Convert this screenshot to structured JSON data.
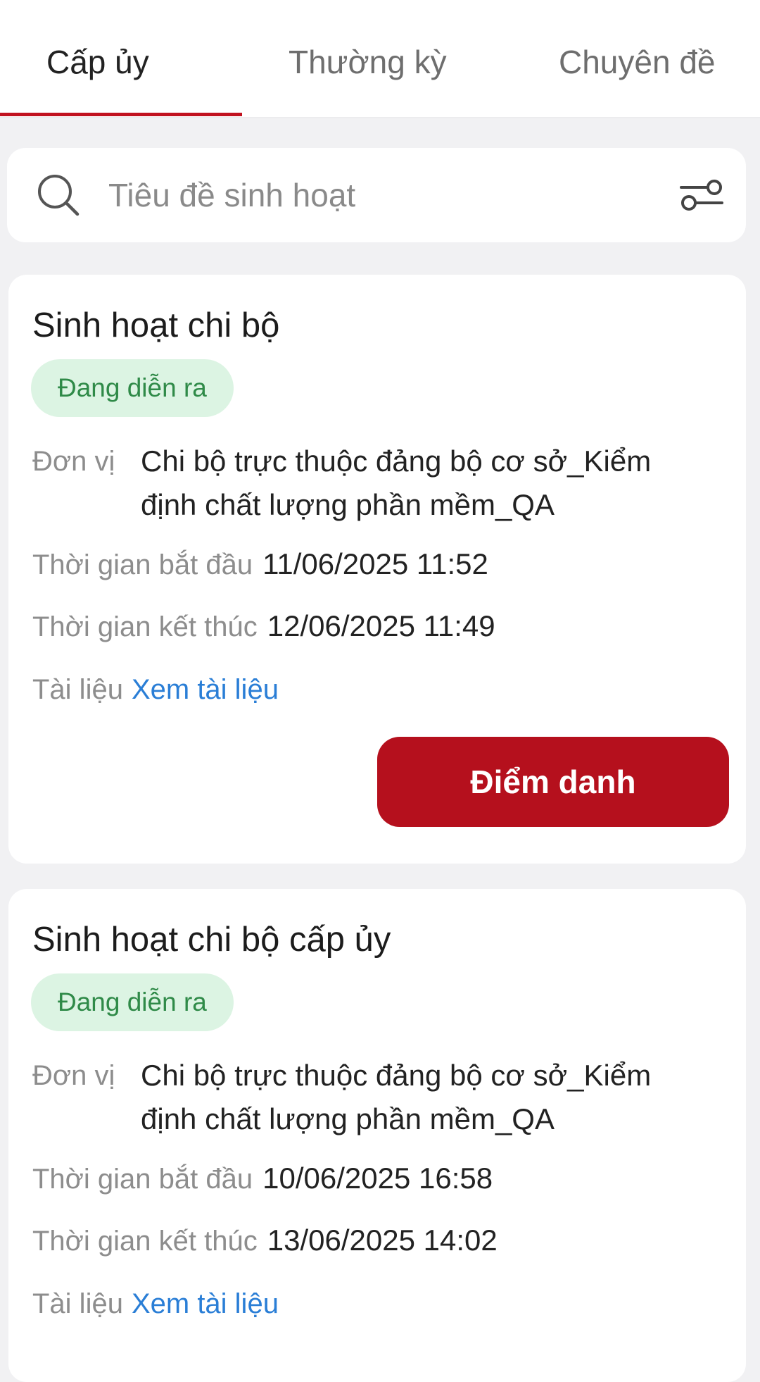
{
  "tabs": [
    {
      "label": "Cấp ủy"
    },
    {
      "label": "Thường kỳ"
    },
    {
      "label": "Chuyên đề"
    }
  ],
  "search": {
    "placeholder": "Tiêu đề sinh hoạt",
    "icon": "search-icon",
    "filter_icon": "filter-sliders-icon"
  },
  "colors": {
    "accent": "#c1121f",
    "button": "#b5101d",
    "badge_bg": "#dcf4e3",
    "badge_text": "#2f8a48",
    "link": "#2a7ed6"
  },
  "cards": [
    {
      "title": "Sinh hoạt chi bộ",
      "status": "Đang diễn ra",
      "unit_label": "Đơn vị",
      "unit_line1": "Chi bộ trực thuộc đảng bộ cơ sở_Kiểm",
      "unit_line2": "định chất lượng phần mềm_QA",
      "start_label": "Thời gian bắt đầu",
      "start": "11/06/2025 11:52",
      "end_label": "Thời gian kết thúc",
      "end": "12/06/2025 11:49",
      "doc_label": "Tài liệu",
      "doc_link": "Xem tài liệu",
      "button": "Điểm danh"
    },
    {
      "title": "Sinh hoạt chi bộ cấp ủy",
      "status": "Đang diễn ra",
      "unit_label": "Đơn vị",
      "unit_line1": "Chi bộ trực thuộc đảng bộ cơ sở_Kiểm",
      "unit_line2": "định chất lượng phần mềm_QA",
      "start_label": "Thời gian bắt đầu",
      "start": "10/06/2025 16:58",
      "end_label": "Thời gian kết thúc",
      "end": "13/06/2025 14:02",
      "doc_label": "Tài liệu",
      "doc_link": "Xem tài liệu"
    }
  ]
}
